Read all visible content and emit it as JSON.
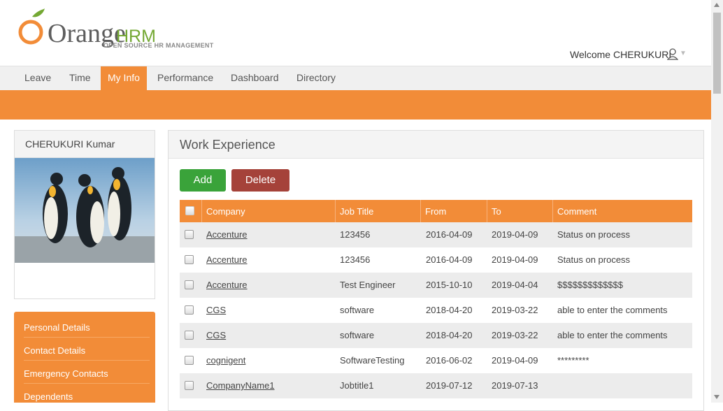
{
  "brand": {
    "logo_main": "Orange",
    "logo_hrm": "HRM",
    "tagline": "OPEN SOURCE HR MANAGEMENT",
    "orange": "#f28c38",
    "green": "#74a833"
  },
  "header": {
    "welcome": "Welcome CHERUKURI"
  },
  "nav": {
    "items": [
      {
        "label": "Leave"
      },
      {
        "label": "Time"
      },
      {
        "label": "My Info"
      },
      {
        "label": "Performance"
      },
      {
        "label": "Dashboard"
      },
      {
        "label": "Directory"
      }
    ],
    "active": "My Info"
  },
  "profile": {
    "name": "CHERUKURI Kumar"
  },
  "sidebar": {
    "items": [
      {
        "label": "Personal Details"
      },
      {
        "label": "Contact Details"
      },
      {
        "label": "Emergency Contacts"
      },
      {
        "label": "Dependents"
      }
    ]
  },
  "work_experience": {
    "title": "Work Experience",
    "add_label": "Add",
    "delete_label": "Delete",
    "columns": [
      "Company",
      "Job Title",
      "From",
      "To",
      "Comment"
    ],
    "rows": [
      {
        "company": "Accenture",
        "job_title": "123456",
        "from": "2016-04-09",
        "to": "2019-04-09",
        "comment": "Status on process"
      },
      {
        "company": "Accenture",
        "job_title": "123456",
        "from": "2016-04-09",
        "to": "2019-04-09",
        "comment": "Status on process"
      },
      {
        "company": "Accenture",
        "job_title": "Test Engineer",
        "from": "2015-10-10",
        "to": "2019-04-04",
        "comment": "$$$$$$$$$$$$$"
      },
      {
        "company": "CGS",
        "job_title": "software",
        "from": "2018-04-20",
        "to": "2019-03-22",
        "comment": "able to enter the comments"
      },
      {
        "company": "CGS",
        "job_title": "software",
        "from": "2018-04-20",
        "to": "2019-03-22",
        "comment": "able to enter the comments"
      },
      {
        "company": "cognigent",
        "job_title": "SoftwareTesting",
        "from": "2016-06-02",
        "to": "2019-04-09",
        "comment": "*********"
      },
      {
        "company": "CompanyName1",
        "job_title": "Jobtitle1",
        "from": "2019-07-12",
        "to": "2019-07-13",
        "comment": ""
      }
    ]
  }
}
